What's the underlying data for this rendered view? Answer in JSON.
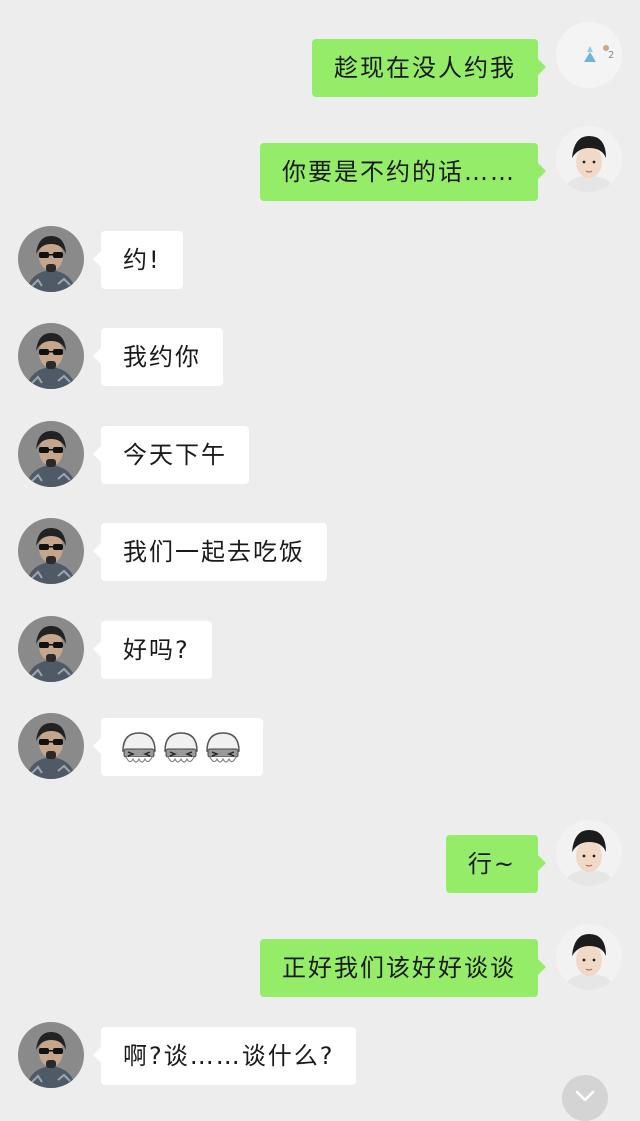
{
  "messages": [
    {
      "side": "out",
      "text": "趁现在没人约我",
      "avatar": "user-avatar-partial"
    },
    {
      "side": "out",
      "text": "你要是不约的话……",
      "avatar": "user-avatar"
    },
    {
      "side": "in",
      "text": "约!",
      "avatar": "contact-avatar"
    },
    {
      "side": "in",
      "text": "我约你",
      "avatar": "contact-avatar"
    },
    {
      "side": "in",
      "text": "今天下午",
      "avatar": "contact-avatar"
    },
    {
      "side": "in",
      "text": "我们一起去吃饭",
      "avatar": "contact-avatar"
    },
    {
      "side": "in",
      "text": "好吗?",
      "avatar": "contact-avatar"
    },
    {
      "side": "in",
      "emoji": [
        "bubble-emoji",
        "bubble-emoji",
        "bubble-emoji"
      ],
      "avatar": "contact-avatar"
    },
    {
      "side": "out",
      "text": "行~",
      "avatar": "user-avatar"
    },
    {
      "side": "out",
      "text": "正好我们该好好谈谈",
      "avatar": "user-avatar"
    },
    {
      "side": "in",
      "text": "啊?谈……谈什么?",
      "avatar": "contact-avatar"
    }
  ],
  "scroll_button": {
    "icon": "chevron-down-icon"
  },
  "colors": {
    "background": "#ededed",
    "outgoing_bubble": "#95ec69",
    "incoming_bubble": "#ffffff"
  }
}
